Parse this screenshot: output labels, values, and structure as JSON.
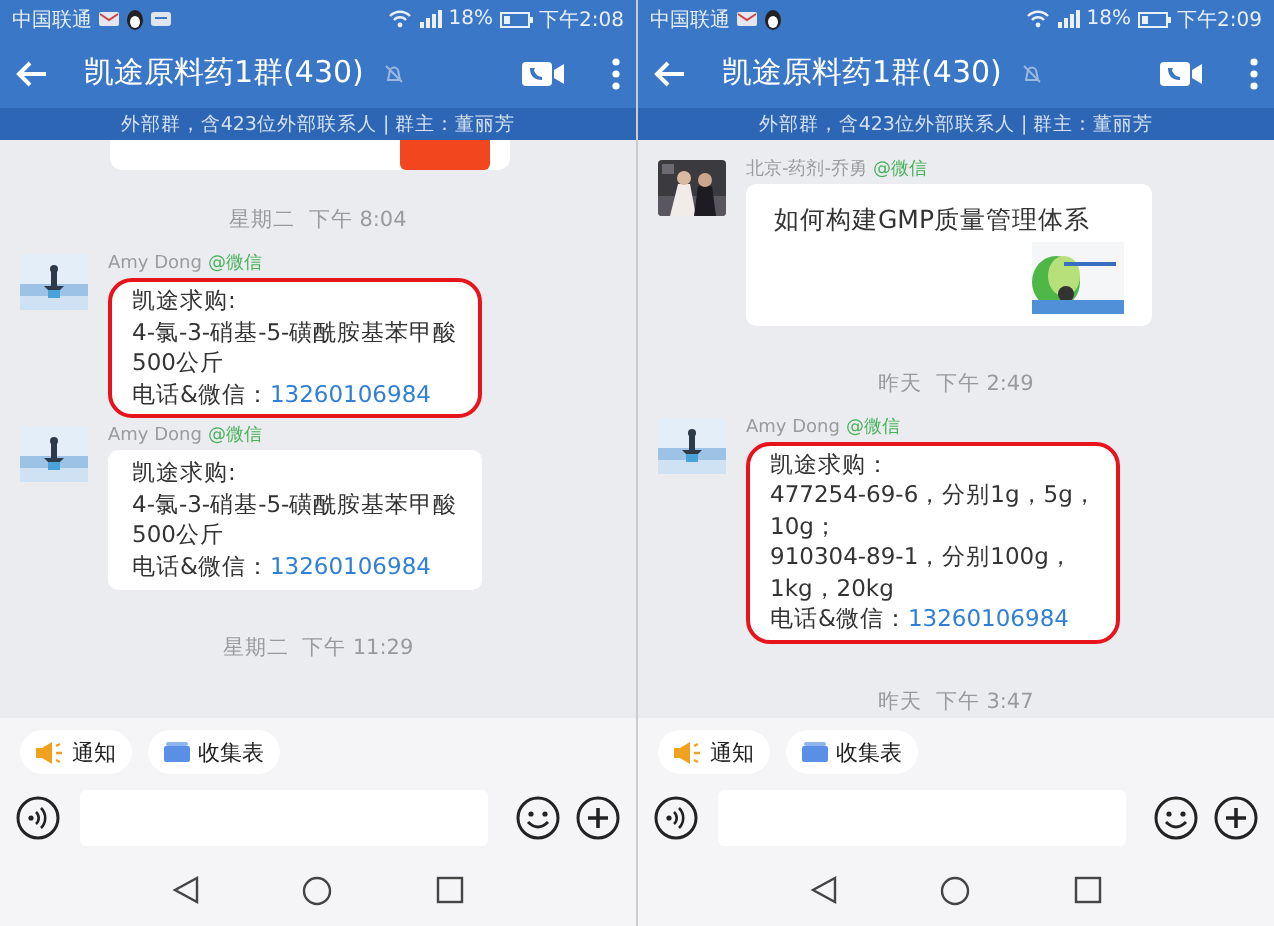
{
  "phones": [
    {
      "status": {
        "carrier": "中国联通",
        "notification_icons": [
          {
            "kind": "mail"
          },
          {
            "kind": "penguin"
          },
          {
            "kind": "sms"
          }
        ],
        "battery": "18%",
        "time": "下午2:08"
      },
      "header": {
        "title": "凯途原料药1群(430)",
        "muted": true,
        "subtitle": "外部群，含423位外部联系人 | 群主：董丽芳"
      },
      "messages": [
        {
          "kind": "card_tail"
        },
        {
          "kind": "time",
          "text": "星期二  下午 8:04"
        },
        {
          "kind": "text",
          "sender": "Amy Dong",
          "source": "@微信",
          "highlighted": true,
          "lines": [
            "凯途求购:",
            "4-氯-3-硝基-5-磺酰胺基苯甲酸",
            "500公斤"
          ],
          "contact_label": "电话&微信：",
          "phone": "13260106984"
        },
        {
          "kind": "text",
          "sender": "Amy Dong",
          "source": "@微信",
          "highlighted": false,
          "lines": [
            "凯途求购:",
            "4-氯-3-硝基-5-磺酰胺基苯甲酸",
            "500公斤"
          ],
          "contact_label": "电话&微信：",
          "phone": "13260106984"
        },
        {
          "kind": "time",
          "text": "星期二  下午 11:29"
        }
      ],
      "quick_actions": [
        {
          "kind": "notice",
          "label": "通知"
        },
        {
          "kind": "form",
          "label": "收集表"
        }
      ]
    },
    {
      "status": {
        "carrier": "中国联通",
        "notification_icons": [
          {
            "kind": "mail"
          },
          {
            "kind": "penguin"
          }
        ],
        "battery": "18%",
        "time": "下午2:09"
      },
      "header": {
        "title": "凯途原料药1群(430)",
        "muted": true,
        "subtitle": "外部群，含423位外部联系人 | 群主：董丽芳"
      },
      "messages": [
        {
          "kind": "link",
          "sender": "北京-药剂-乔勇",
          "source": "@微信",
          "title": "如何构建GMP质量管理体系"
        },
        {
          "kind": "time",
          "text": "昨天  下午 2:49"
        },
        {
          "kind": "text",
          "sender": "Amy Dong",
          "source": "@微信",
          "highlighted": true,
          "lines": [
            "凯途求购：",
            "477254-69-6，分别1g，5g，",
            "10g；",
            "910304-89-1，分别100g，",
            "1kg，20kg"
          ],
          "contact_label": "电话&微信：",
          "phone": "13260106984"
        },
        {
          "kind": "time",
          "text": "昨天  下午 3:47"
        }
      ],
      "quick_actions": [
        {
          "kind": "notice",
          "label": "通知"
        },
        {
          "kind": "form",
          "label": "收集表"
        }
      ]
    }
  ]
}
